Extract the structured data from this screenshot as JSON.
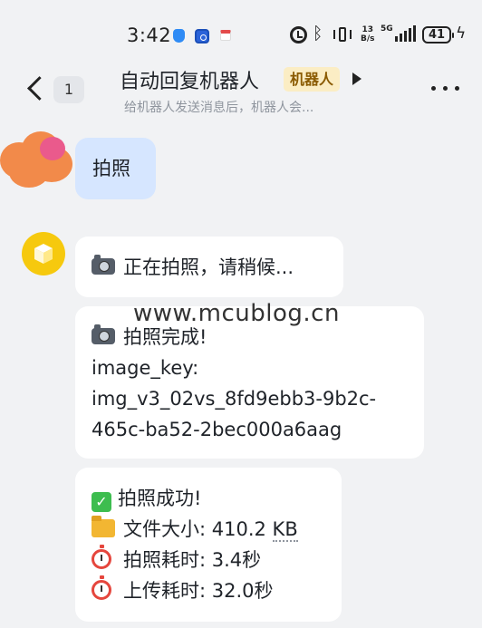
{
  "status_bar": {
    "time": "3:42",
    "net_speed_value": "13",
    "net_speed_unit": "B/s",
    "network_type": "5G",
    "battery": "41",
    "icons": [
      "shield-app-icon",
      "browser-app-icon",
      "calendar-app-icon",
      "alarm-icon",
      "bluetooth-icon",
      "vibrate-icon",
      "signal-icon",
      "battery-icon",
      "charging-icon"
    ]
  },
  "header": {
    "unread_count": "1",
    "title": "自动回复机器人",
    "tag": "机器人",
    "subtitle": "给机器人发送消息后，机器人会..."
  },
  "messages": [
    {
      "from": "user",
      "text": "拍照"
    },
    {
      "from": "bot",
      "lines": [
        {
          "icon": "camera-icon",
          "text": "正在拍照，请稍候..."
        }
      ]
    },
    {
      "from": "bot",
      "lines": [
        {
          "icon": "camera-icon",
          "text": "拍照完成!"
        },
        {
          "text": "image_key:"
        },
        {
          "text": "img_v3_02vs_8fd9ebb3-9b2c-"
        },
        {
          "text": "465c-ba52-2bec000a6aag"
        }
      ]
    },
    {
      "from": "bot",
      "lines": [
        {
          "icon": "check-mark-icon",
          "text": "拍照成功!"
        },
        {
          "icon": "folder-icon",
          "text_prefix": "文件大小: 410.2 ",
          "text_unit": "KB"
        },
        {
          "icon": "stopwatch-icon",
          "text": "拍照耗时: 3.4秒"
        },
        {
          "icon": "stopwatch-icon",
          "text": "上传耗时: 32.0秒"
        }
      ]
    }
  ],
  "watermark": "www.mcublog.cn",
  "colors": {
    "background": "#f1f2f4",
    "user_bubble": "#d6e6ff",
    "bot_bubble": "#ffffff",
    "tag_bg": "#fbedc4",
    "tag_text": "#8a5a00",
    "bot_avatar": "#f6c90e",
    "user_avatar_scribble": "#f28a4a"
  }
}
